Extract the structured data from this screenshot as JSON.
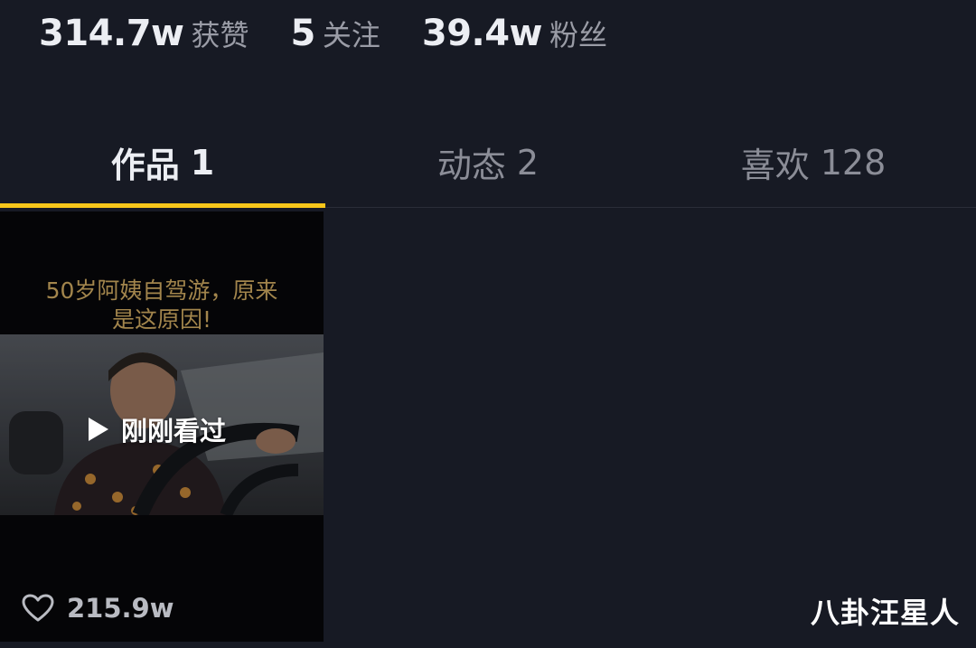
{
  "stats": [
    {
      "value": "314.7w",
      "label": "获赞"
    },
    {
      "value": "5",
      "label": "关注"
    },
    {
      "value": "39.4w",
      "label": "粉丝"
    }
  ],
  "tabs": [
    {
      "label": "作品",
      "count": "1",
      "active": true
    },
    {
      "label": "动态",
      "count": "2",
      "active": false
    },
    {
      "label": "喜欢",
      "count": "128",
      "active": false
    }
  ],
  "video": {
    "caption_line1": "50岁阿姨自驾游，原来",
    "caption_line2": "是这原因!",
    "watched_label": "刚刚看过",
    "likes": "215.9w",
    "play_icon": "play-icon",
    "like_icon": "heart-icon"
  },
  "watermark": "八卦汪星人",
  "colors": {
    "background": "#171a24",
    "active_tab_indicator": "#f7c61a",
    "caption": "#a2854c"
  }
}
